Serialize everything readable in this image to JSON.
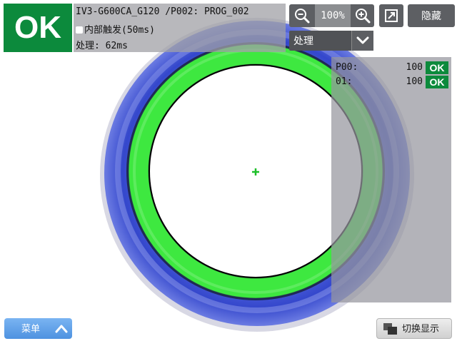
{
  "judgement": "OK",
  "header": {
    "device_program": "IV3-G600CA_G120 /P002: PROG_002",
    "trigger": "内部触发(50ms)",
    "processing_time": "处理: 62ms"
  },
  "toolbar": {
    "zoom_level": "100%",
    "zoom_out_icon": "zoom-out-icon",
    "zoom_in_icon": "zoom-in-icon",
    "expand_icon": "expand-icon",
    "hide_label": "隐藏"
  },
  "view_select": {
    "value": "处理",
    "icon": "chevron-down-icon"
  },
  "tools": [
    {
      "name": "P00:",
      "value": "100",
      "status": "OK"
    },
    {
      "name": "01:",
      "value": "100",
      "status": "OK"
    }
  ],
  "footer": {
    "menu_label": "菜单",
    "menu_icon": "chevron-up-icon",
    "switch_label": "切换显示",
    "switch_icon": "window-switch-icon"
  },
  "colors": {
    "ok_green": "#0c8a3c",
    "ring_blue": "#3b4fd0",
    "ring_green": "#3ee840",
    "panel_gray": "#5d5f63",
    "menu_blue": "#4e92e0"
  }
}
